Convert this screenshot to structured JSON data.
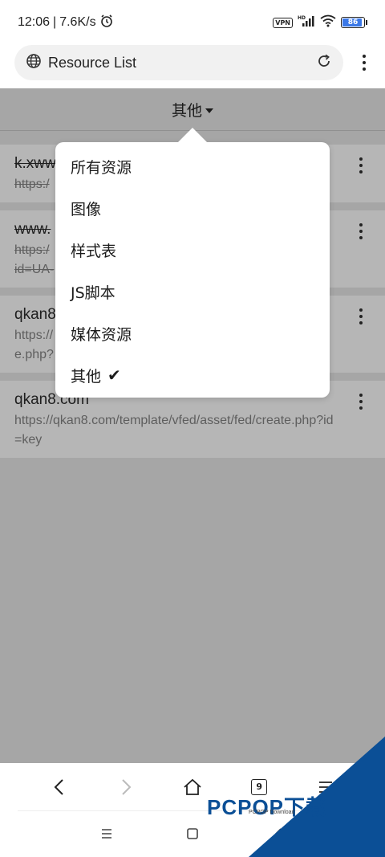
{
  "status_bar": {
    "time": "12:06",
    "separator": "|",
    "speed": "7.6K/s",
    "vpn": "VPN",
    "hd": "HD",
    "battery": "86"
  },
  "url_bar": {
    "title": "Resource List"
  },
  "filter": {
    "label": "其他"
  },
  "rows": [
    {
      "title": "k.xww",
      "url": "https:/",
      "struck": true
    },
    {
      "title": "www.",
      "url": "https:/",
      "url2": "id=UA-",
      "struck": true
    },
    {
      "title": "qkan8",
      "url": "https://",
      "url2": "e.php?",
      "struck": false
    },
    {
      "title": "qkan8.com",
      "url": "https://qkan8.com/template/vfed/asset/fed/create.php?id=key",
      "struck": false
    }
  ],
  "dropdown": {
    "items": [
      {
        "label": "所有资源",
        "checked": false
      },
      {
        "label": "图像",
        "checked": false
      },
      {
        "label": "样式表",
        "checked": false
      },
      {
        "label": "JS脚本",
        "checked": false
      },
      {
        "label": "媒体资源",
        "checked": false
      },
      {
        "label": "其他",
        "checked": true
      }
    ],
    "check_glyph": "✔"
  },
  "bottom_nav": {
    "tab_count": "9"
  },
  "watermark": {
    "brand": "PCPOP下载",
    "sub": "PCPOP Download"
  },
  "colors": {
    "overlay": "#a6a6a6",
    "row_bg": "#b6b6b6",
    "battery": "#3b78e7",
    "watermark": "#0b4f96"
  }
}
